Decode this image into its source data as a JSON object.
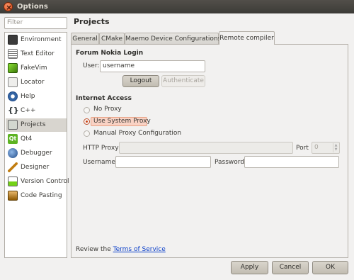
{
  "window": {
    "title": "Options"
  },
  "sidebar": {
    "filter_placeholder": "Filter",
    "items": [
      {
        "label": "Environment",
        "icon": "monitor-icon",
        "color": "#555753"
      },
      {
        "label": "Text Editor",
        "icon": "text-editor-icon",
        "color": "#8a8a8a"
      },
      {
        "label": "FakeVim",
        "icon": "fakevim-icon",
        "color": "#4e9a06"
      },
      {
        "label": "Locator",
        "icon": "locator-icon",
        "color": "#729fcf"
      },
      {
        "label": "Help",
        "icon": "help-icon",
        "color": "#3465a4"
      },
      {
        "label": "C++",
        "icon": "cpp-braces-icon",
        "color": "#2e3436"
      },
      {
        "label": "Projects",
        "icon": "projects-icon",
        "color": "#888a85"
      },
      {
        "label": "Qt4",
        "icon": "qt4-icon",
        "color": "#4e9a06"
      },
      {
        "label": "Debugger",
        "icon": "debugger-icon",
        "color": "#204a87"
      },
      {
        "label": "Designer",
        "icon": "designer-icon",
        "color": "#c17d11"
      },
      {
        "label": "Version Control",
        "icon": "version-control-icon",
        "color": "#73d216"
      },
      {
        "label": "Code Pasting",
        "icon": "code-pasting-icon",
        "color": "#8f5902"
      }
    ],
    "selected": "Projects"
  },
  "main": {
    "title": "Projects",
    "tabs": [
      {
        "label": "General"
      },
      {
        "label": "CMake"
      },
      {
        "label": "Maemo Device Configurations"
      },
      {
        "label": "Remote compiler"
      }
    ],
    "active_tab": "Remote compiler",
    "login": {
      "section_title": "Forum Nokia Login",
      "user_label": "User:",
      "user_value": "username",
      "logout_label": "Logout",
      "authenticate_label": "Authenticate"
    },
    "internet": {
      "section_title": "Internet Access",
      "options": [
        {
          "label": "No Proxy",
          "selected": false
        },
        {
          "label": "Use System Proxy",
          "selected": true
        },
        {
          "label": "Manual Proxy Configuration",
          "selected": false
        }
      ],
      "http_proxy_label": "HTTP Proxy",
      "http_proxy_value": "",
      "port_label": "Port",
      "port_value": "0",
      "username_label": "Username",
      "username_value": "",
      "password_label": "Password",
      "password_value": ""
    },
    "review_prefix": "Review the ",
    "review_link": "Terms of Service"
  },
  "footer": {
    "apply_label": "Apply",
    "cancel_label": "Cancel",
    "ok_label": "OK"
  }
}
